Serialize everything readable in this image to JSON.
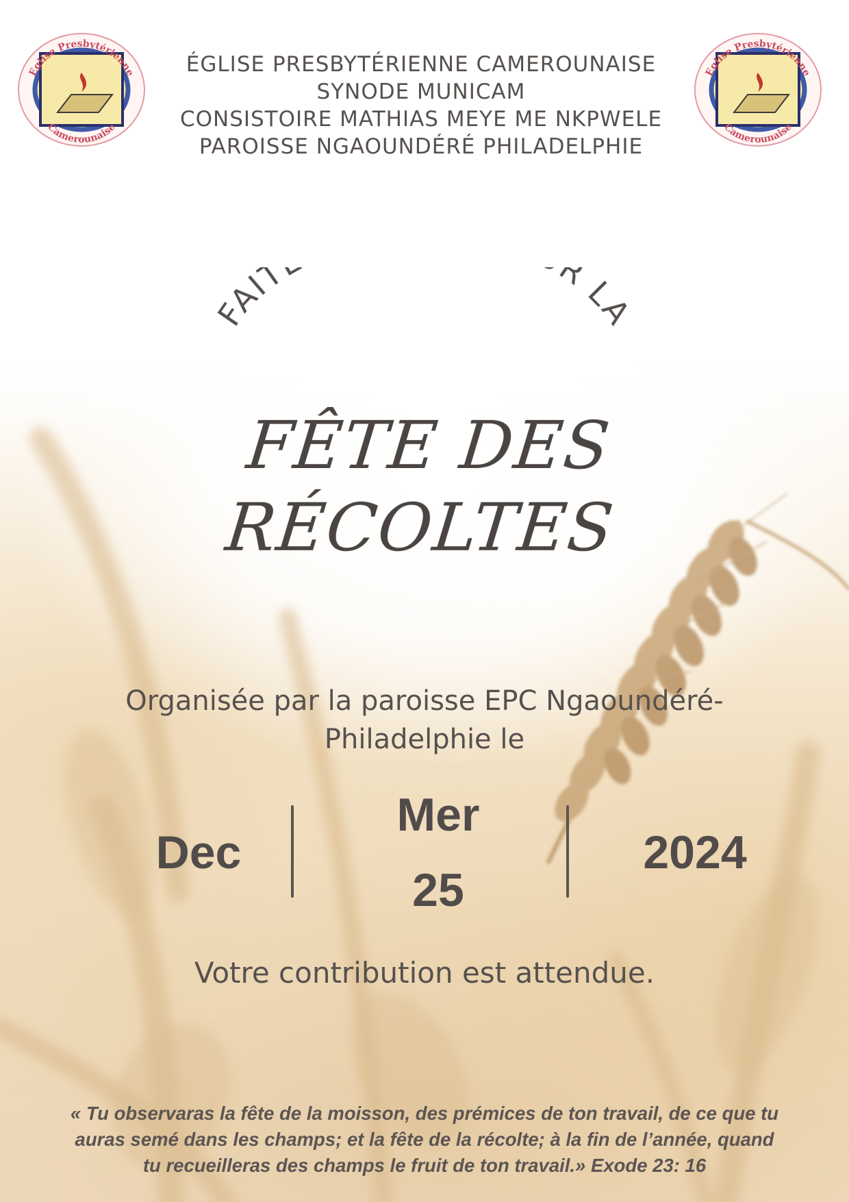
{
  "header": {
    "lines": [
      "ÉGLISE PRESBYTÉRIENNE CAMEROUNAISE",
      "SYNODE MUNICAM",
      "CONSISTOIRE MATHIAS MEYE ME NKPWELE",
      "PAROISSE NGAOUNDÉRÉ PHILADELPHIE"
    ]
  },
  "logo": {
    "text_top": "Eglise Presbytérienne",
    "text_bottom": "Camerounaise"
  },
  "title": {
    "arc_text": "FAITES UN DON POUR LA",
    "line1": "FÊTE DES",
    "line2": "RÉCOLTES"
  },
  "organized": {
    "line1": "Organisée par la paroisse EPC Ngaoundéré-",
    "line2": "Philadelphie le"
  },
  "date": {
    "month": "Dec",
    "weekday": "Mer",
    "day": "25",
    "year": "2024"
  },
  "contribution": "Votre contribution est attendue.",
  "verse": {
    "line1": "« Tu observaras la fête de la moisson, des prémices de ton travail, de ce que tu",
    "line2": "auras semé dans les champs; et la fête de la récolte; à la fin de l’année, quand",
    "line3": "tu recueilleras des champs le fruit de ton travail.» Exode 23: 16"
  },
  "colors": {
    "text": "#56514e",
    "logo_ring": "#d9667a",
    "logo_square": "#3f5aa6",
    "logo_fill": "#f4e6a0",
    "wheat": "#c9a77a"
  }
}
